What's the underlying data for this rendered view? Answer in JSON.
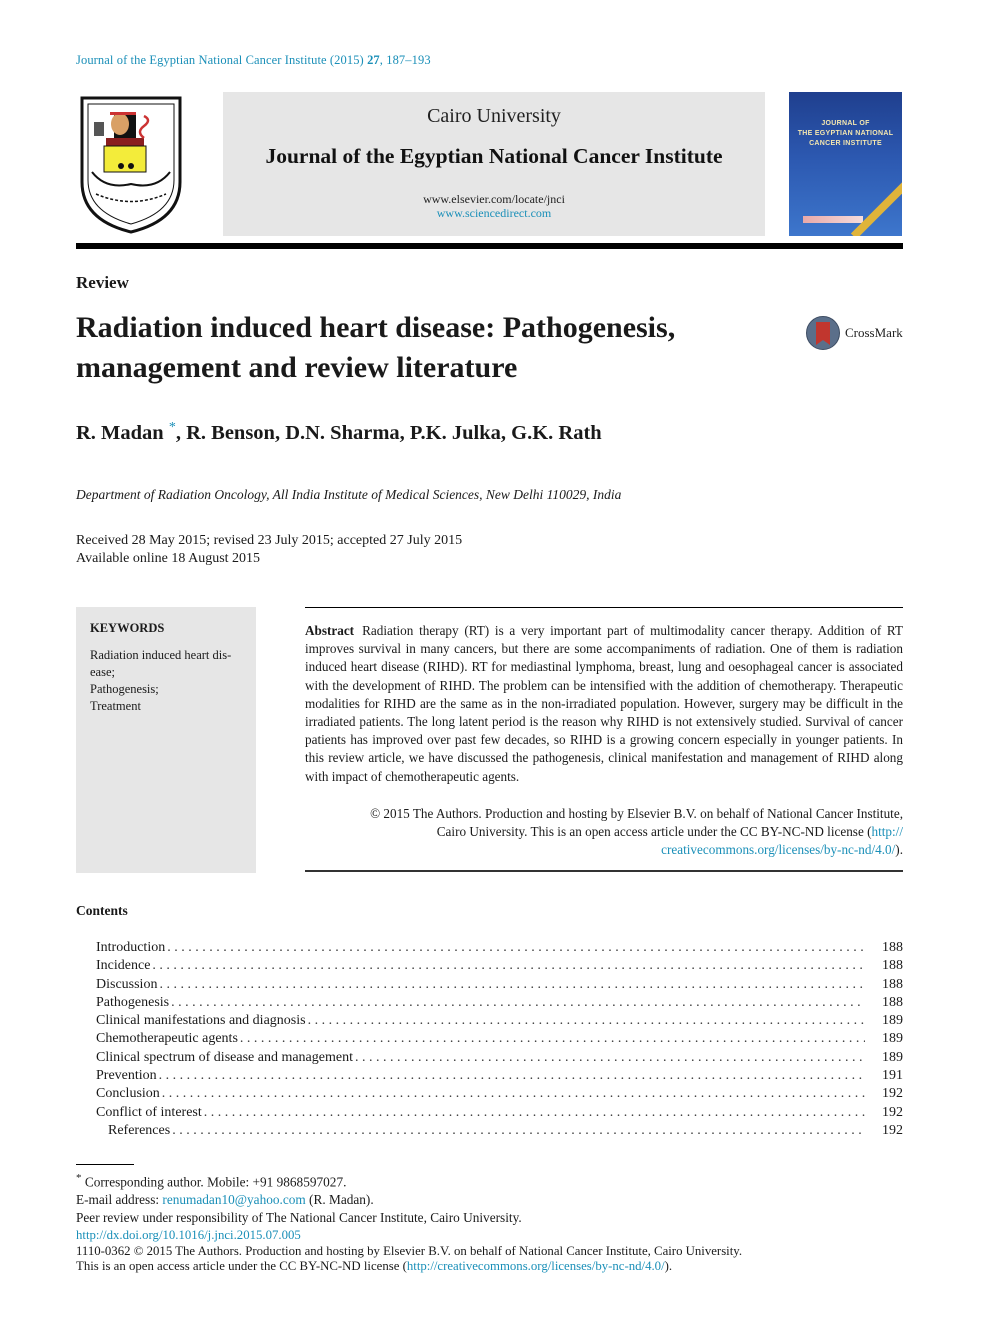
{
  "citation": {
    "journal": "Journal of the Egyptian National Cancer Institute (2015)",
    "volume": "27",
    "pages": ", 187–193"
  },
  "header": {
    "university": "Cairo University",
    "journal_name": "Journal of the Egyptian National Cancer Institute",
    "url_elsevier": "www.elsevier.com/locate/jnci",
    "url_sciencedirect": "www.sciencedirect.com",
    "cover_title_lines": [
      "JOURNAL OF",
      "THE EGYPTIAN NATIONAL",
      "CANCER INSTITUTE"
    ]
  },
  "article": {
    "type": "Review",
    "title": "Radiation induced heart disease: Pathogenesis, management and review literature",
    "crossmark_label": "CrossMark",
    "authors_first": "R. Madan",
    "authors_mark": "*",
    "authors_rest": ", R. Benson, D.N. Sharma, P.K. Julka, G.K. Rath",
    "affiliation": "Department of Radiation Oncology, All India Institute of Medical Sciences, New Delhi 110029, India",
    "dates_line1": "Received 28 May 2015; revised 23 July 2015; accepted 27 July 2015",
    "dates_line2": "Available online 18 August 2015"
  },
  "keywords": {
    "heading": "KEYWORDS",
    "items": [
      "Radiation induced heart dis-ease;",
      "Pathogenesis;",
      "Treatment"
    ]
  },
  "abstract": {
    "lead": "Abstract",
    "text": "Radiation therapy (RT) is a very important part of multimodality cancer therapy. Addition of RT improves survival in many cancers, but there are some accompaniments of radiation. One of them is radiation induced heart disease (RIHD). RT for mediastinal lymphoma, breast, lung and oesophageal cancer is associated with the development of RIHD. The problem can be intensified with the addition of chemotherapy. Therapeutic modalities for RIHD are the same as in the non-irradiated population. However, surgery may be difficult in the irradiated patients. The long latent period is the reason why RIHD is not extensively studied. Survival of cancer patients has improved over past few decades, so RIHD is a growing concern especially in younger patients. In this review article, we have discussed the pathogenesis, clinical manifestation and management of RIHD along with impact of chemotherapeutic agents.",
    "copyright_line1": "© 2015 The Authors. Production and hosting by Elsevier B.V. on behalf of National Cancer Institute,",
    "copyright_line2": "Cairo University.  This is an open access article under the CC BY-NC-ND license (",
    "license_link_part1": "http://",
    "license_link_part2": "creativecommons.org/licenses/by-nc-nd/4.0/",
    "license_close": ")."
  },
  "contents": {
    "heading": "Contents",
    "items": [
      {
        "title": "Introduction",
        "page": "188"
      },
      {
        "title": "Incidence",
        "page": "188"
      },
      {
        "title": "Discussion",
        "page": "188"
      },
      {
        "title": "Pathogenesis",
        "page": "188"
      },
      {
        "title": "Clinical manifestations and diagnosis",
        "page": "189"
      },
      {
        "title": "Chemotherapeutic agents",
        "page": "189"
      },
      {
        "title": "Clinical spectrum of disease and management",
        "page": "189"
      },
      {
        "title": "Prevention",
        "page": "191"
      },
      {
        "title": "Conclusion",
        "page": "192"
      },
      {
        "title": "Conflict of interest",
        "page": "192"
      },
      {
        "title": "References",
        "page": "192"
      }
    ]
  },
  "footnotes": {
    "mark": "*",
    "corresponding": " Corresponding author. Mobile: +91 9868597027.",
    "email_label": "E-mail address: ",
    "email": "renumadan10@yahoo.com",
    "email_suffix": " (R. Madan).",
    "peer_review": "Peer review under responsibility of The National Cancer Institute, Cairo University."
  },
  "doi": {
    "url": "http://dx.doi.org/10.1016/j.jnci.2015.07.005",
    "issn_line": "1110-0362 © 2015 The Authors. Production and hosting by Elsevier B.V. on behalf of National Cancer Institute, Cairo University.",
    "license_prefix": "This is an open access article under the CC BY-NC-ND license (",
    "license_url": "http://creativecommons.org/licenses/by-nc-nd/4.0/",
    "license_suffix": ")."
  }
}
